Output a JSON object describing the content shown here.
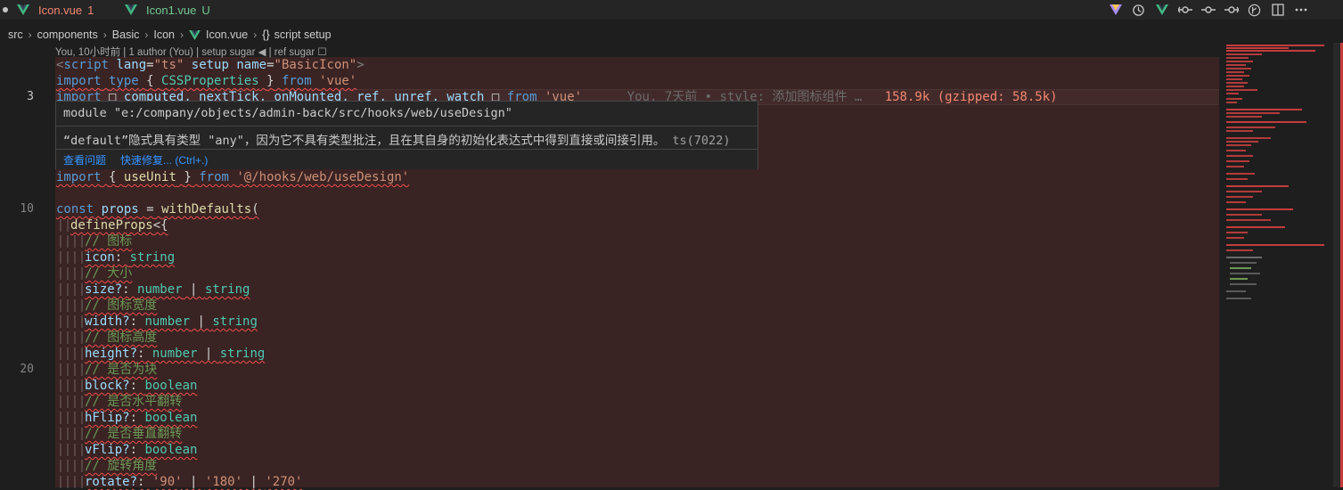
{
  "tabs": [
    {
      "name": "Icon.vue",
      "count": "1"
    },
    {
      "name": "Icon1.vue",
      "badge": "U"
    }
  ],
  "toolbar_icons": [
    "vue-icon",
    "history-icon",
    "vue-outline-icon",
    "go-back-icon",
    "git-commit-icon",
    "go-forward-icon",
    "git-graph-icon",
    "split-editor-icon",
    "more-icon"
  ],
  "breadcrumb": [
    "src",
    "components",
    "Basic",
    "Icon",
    "Icon.vue",
    "script setup"
  ],
  "codelens": "You, 10小时前 | 1 author (You) | setup sugar ◀ | ref sugar ☐",
  "line_numbers": [
    {
      "n": "3",
      "current": true
    },
    {
      "n": "10",
      "current": false
    },
    {
      "n": "20",
      "current": false
    }
  ],
  "code": {
    "l1": {
      "open": "<",
      "tag": "script",
      "a1": "lang",
      "v1": "\"ts\"",
      "a2": "setup",
      "a3": "name",
      "v3": "\"BasicIcon\"",
      "close": ">"
    },
    "l2": {
      "kw": "import",
      "kw2": "type",
      "lb": "{",
      "id": "CSSProperties",
      "rb": "}",
      "from": "from",
      "src": "'vue'"
    },
    "l3": {
      "kw": "import",
      "box": "□",
      "names": "computed, nextTick, onMounted, ref, unref, watch",
      "box2": "□",
      "from": "from",
      "src": "'vue'",
      "blame": "You, 7天前 • style: 添加图标组件 …",
      "size": "158.9k (gzipped: 58.5k)"
    },
    "l9": {
      "kw": "import",
      "lb": "{",
      "id": "useUnit",
      "rb": "}",
      "from": "from",
      "src": "'@/hooks/web/useDesign'"
    },
    "l11": {
      "kw": "const",
      "id": "props",
      "eq": "=",
      "fn": "withDefaults",
      "paren": "("
    },
    "l12": {
      "fn": "defineProps",
      "open": "<{"
    },
    "props": [
      {
        "comment": "// 图标",
        "name": "icon",
        "types": [
          "string"
        ]
      },
      {
        "comment": "// 大小",
        "name": "size?",
        "types": [
          "number",
          "string"
        ]
      },
      {
        "comment": "// 图标宽度",
        "name": "width?",
        "types": [
          "number",
          "string"
        ]
      },
      {
        "comment": "// 图标高度",
        "name": "height?",
        "types": [
          "number",
          "string"
        ]
      },
      {
        "comment": "// 是否为块",
        "name": "block?",
        "types": [
          "boolean"
        ]
      },
      {
        "comment": "// 是否水平翻转",
        "name": "hFlip?",
        "types": [
          "boolean"
        ]
      },
      {
        "comment": "// 是否垂直翻转",
        "name": "vFlip?",
        "types": [
          "boolean"
        ]
      },
      {
        "comment": "// 旋转角度",
        "name": "rotate?",
        "types": [
          "'90'",
          "'180'",
          "'270'"
        ]
      }
    ]
  },
  "hover": {
    "module": "module \"e:/company/objects/admin-back/src/hooks/web/useDesign\"",
    "message": "“default”隐式具有类型 \"any\"，因为它不具有类型批注，且在其自身的初始化表达式中得到直接或间接引用。",
    "code": "ts(7022)",
    "view_problem": "查看问题",
    "quick_fix": "快速修复... (Ctrl+.)"
  },
  "colors": {
    "error": "#f14c4c",
    "modified": "#f48771",
    "untracked": "#73c991",
    "vue": "#41b883",
    "link": "#3794ff"
  }
}
